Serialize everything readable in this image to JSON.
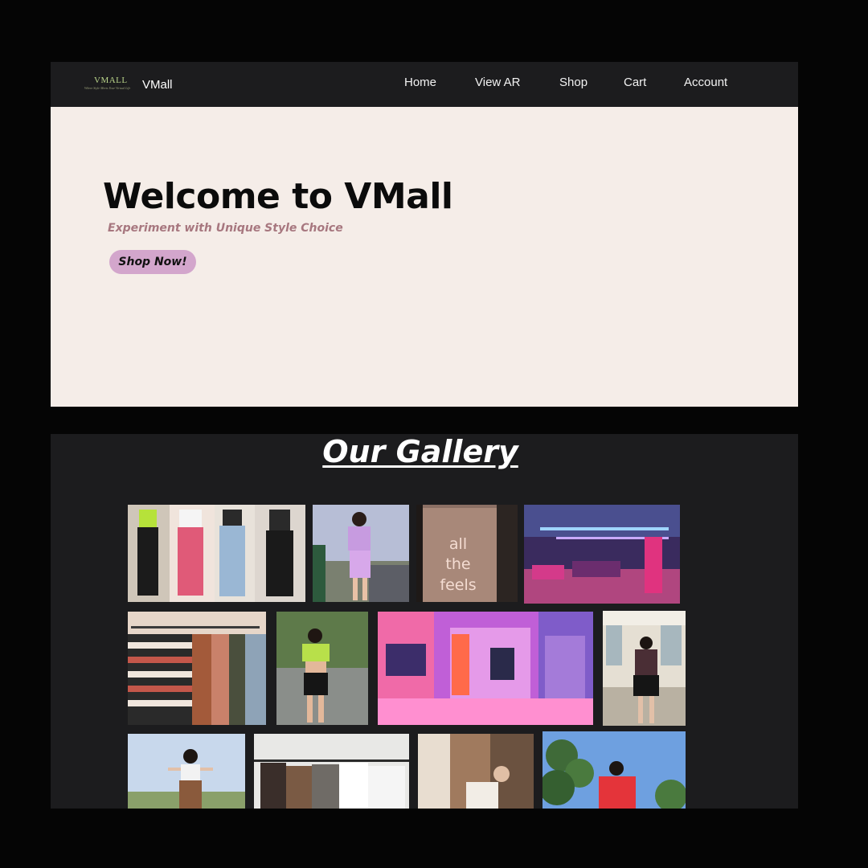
{
  "nav": {
    "logo_text": "VMALL",
    "logo_tagline": "Where Style Meets Your Virtual Life",
    "brand": "VMall",
    "items": [
      {
        "label": "Home"
      },
      {
        "label": "View AR"
      },
      {
        "label": "Shop"
      },
      {
        "label": "Cart"
      },
      {
        "label": "Account"
      }
    ]
  },
  "hero": {
    "title": "Welcome to VMall",
    "subtitle": "Experiment with Unique Style Choice",
    "cta": "Shop Now!"
  },
  "gallery": {
    "title": "Our Gallery",
    "neon_sign": [
      "all",
      "the",
      "feels"
    ]
  },
  "colors": {
    "navbar": "#1c1c1e",
    "hero_bg": "#f5ede8",
    "accent_pink": "#d3a6cc",
    "subtitle": "#a7777f"
  }
}
